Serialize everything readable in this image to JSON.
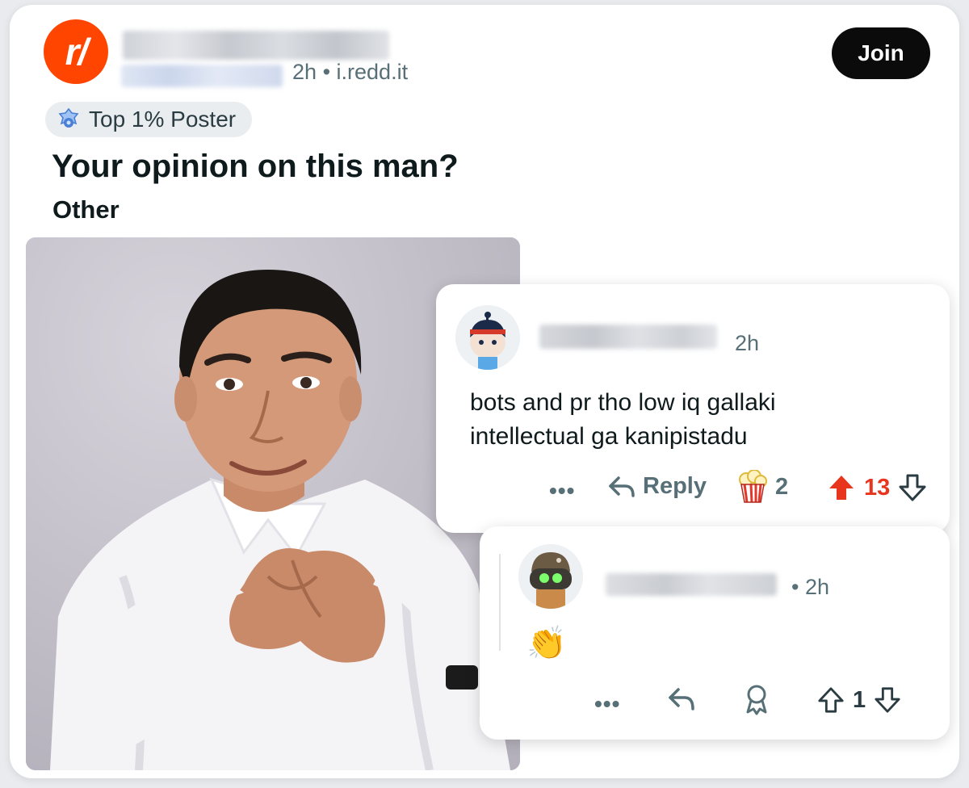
{
  "post": {
    "subreddit_logo_text": "r/",
    "age": "2h",
    "separator": "•",
    "domain": "i.redd.it",
    "join_label": "Join",
    "flair_label": "Top 1% Poster",
    "title": "Your opinion on this man?",
    "tag": "Other"
  },
  "comments": [
    {
      "time": "2h",
      "body_line1": "bots and pr tho low iq gallaki",
      "body_line2": "intellectual ga kanipistadu",
      "more": "•••",
      "reply_label": "Reply",
      "award_count": "2",
      "score": "13",
      "vote_state": "upvoted"
    },
    {
      "time": "• 2h",
      "body": "👏",
      "more": "•••",
      "score": "1"
    }
  ],
  "colors": {
    "accent_orange": "#ff4500",
    "upvote_red": "#e8351e",
    "meta_gray": "#576f76"
  }
}
